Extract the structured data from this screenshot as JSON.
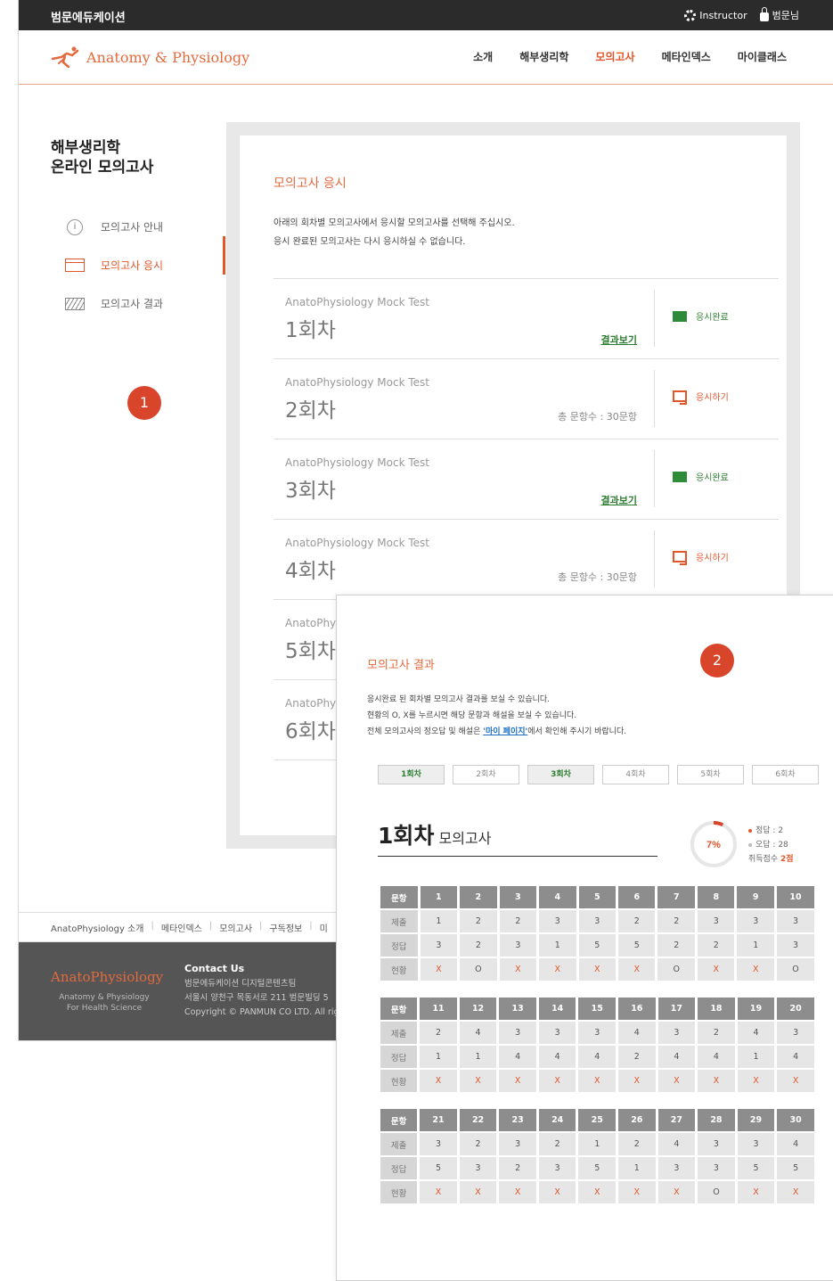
{
  "topbar": {
    "brand": "범문에듀케이션",
    "instructor": "Instructor",
    "user": "범문님"
  },
  "logo": {
    "title": "Anatomy & Physiology"
  },
  "gnb": [
    {
      "label": "소개"
    },
    {
      "label": "해부생리학"
    },
    {
      "label": "모의고사",
      "active": true
    },
    {
      "label": "메타인덱스"
    },
    {
      "label": "마이클래스"
    }
  ],
  "side": {
    "title_line1": "해부생리학",
    "title_line2": "온라인 모의고사",
    "menu": [
      {
        "label": "모의고사 안내",
        "icon": "info-icon"
      },
      {
        "label": "모의고사 응시",
        "icon": "window-icon",
        "active": true
      },
      {
        "label": "모의고사 결과",
        "icon": "board-icon"
      }
    ]
  },
  "main": {
    "title": "모의고사 응시",
    "desc1": "아래의 회차별 모의고사에서 응시할 모의고사를 선택해 주십시오.",
    "desc2": "응시 완료된 모의고사는 다시 응시하실 수 없습니다.",
    "tests": [
      {
        "sub": "AnatoPhysiology Mock Test",
        "name": "1회차",
        "mid": "결과보기",
        "status": "응시완료"
      },
      {
        "sub": "AnatoPhysiology Mock Test",
        "name": "2회차",
        "mid": "총 문항수 : 30문항",
        "status": "응시하기"
      },
      {
        "sub": "AnatoPhysiology Mock Test",
        "name": "3회차",
        "mid": "결과보기",
        "status": "응시완료"
      },
      {
        "sub": "AnatoPhysiology Mock Test",
        "name": "4회차",
        "mid": "총 문항수 : 30문항",
        "status": "응시하기"
      },
      {
        "sub": "AnatoPhysiol",
        "name": "5회차"
      },
      {
        "sub": "AnatoPhysiol",
        "name": "6회차"
      }
    ]
  },
  "badges": {
    "one": "1",
    "two": "2"
  },
  "footlinks": [
    "AnatoPhysiology 소개",
    "메타인덱스",
    "모의고사",
    "구독정보",
    "미"
  ],
  "footer": {
    "logo": "AnatoPhysiology",
    "sub1": "Anatomy & Physiology",
    "sub2": "For Health Science",
    "contact_title": "Contact Us",
    "contact1": "범문에듀케이션 디지털콘텐츠팀",
    "contact2": "서울시 양천구 목동서로 211 범문빌딩 5",
    "contact3": "Copyright © PANMUN CO LTD. All righ"
  },
  "result": {
    "title": "모의고사 결과",
    "desc1": "응시완료 된 회차별 모의고사 결과를 보실 수 있습니다.",
    "desc2": "현황의 O, X를 누르시면 해당 문항과 해설을 보실 수 있습니다.",
    "desc3_pre": "전체 모의고사의 정오답 및 해설은 ",
    "desc3_link": "'마이 페이지'",
    "desc3_post": "에서 확인해 주시기 바랍니다.",
    "tabs": [
      "1회차",
      "2회차",
      "3회차",
      "4회차",
      "5회차",
      "6회차"
    ],
    "heading_big": "1회차",
    "heading_small": "모의고사",
    "percent": "7%",
    "percent_value": 0.07,
    "correct": "정답 : 2",
    "wrong": "오답 : 28",
    "cancel_label": "취득점수 ",
    "cancel_value": "2점",
    "row_labels": {
      "q": "문항",
      "submit": "제출",
      "answer": "정답",
      "status": "현황"
    },
    "blocks": [
      {
        "q": [
          "1",
          "2",
          "3",
          "4",
          "5",
          "6",
          "7",
          "8",
          "9",
          "10"
        ],
        "submit": [
          "1",
          "2",
          "2",
          "3",
          "3",
          "2",
          "2",
          "3",
          "3",
          "3"
        ],
        "answer": [
          "3",
          "2",
          "3",
          "1",
          "5",
          "5",
          "2",
          "2",
          "1",
          "3"
        ],
        "status": [
          "X",
          "O",
          "X",
          "X",
          "X",
          "X",
          "O",
          "X",
          "X",
          "O"
        ]
      },
      {
        "q": [
          "11",
          "12",
          "13",
          "14",
          "15",
          "16",
          "17",
          "18",
          "19",
          "20"
        ],
        "submit": [
          "2",
          "4",
          "3",
          "3",
          "3",
          "4",
          "3",
          "2",
          "4",
          "3"
        ],
        "answer": [
          "1",
          "1",
          "4",
          "4",
          "4",
          "2",
          "4",
          "4",
          "1",
          "4"
        ],
        "status": [
          "X",
          "X",
          "X",
          "X",
          "X",
          "X",
          "X",
          "X",
          "X",
          "X"
        ]
      },
      {
        "q": [
          "21",
          "22",
          "23",
          "24",
          "25",
          "26",
          "27",
          "28",
          "29",
          "30"
        ],
        "submit": [
          "3",
          "2",
          "3",
          "2",
          "1",
          "2",
          "4",
          "3",
          "3",
          "4"
        ],
        "answer": [
          "5",
          "3",
          "2",
          "3",
          "5",
          "1",
          "3",
          "3",
          "5",
          "5"
        ],
        "status": [
          "X",
          "X",
          "X",
          "X",
          "X",
          "X",
          "X",
          "O",
          "X",
          "X"
        ]
      }
    ]
  }
}
